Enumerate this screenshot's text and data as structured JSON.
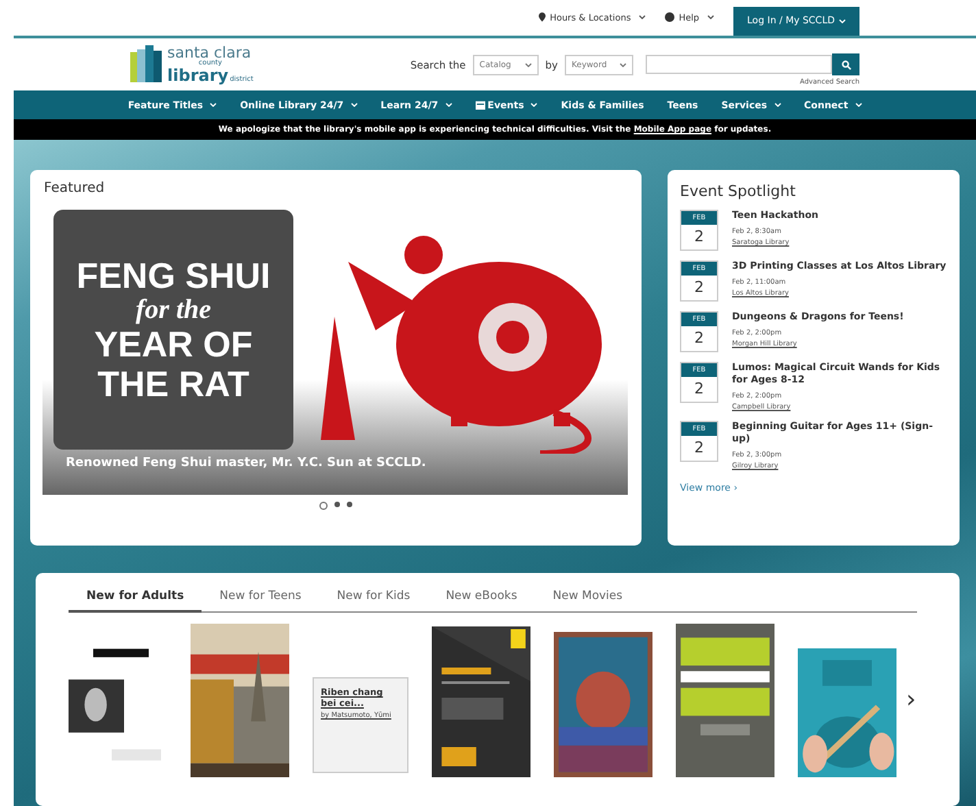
{
  "utility_bar": {
    "links": [
      {
        "label": "Hours & Locations"
      },
      {
        "label": "Help"
      }
    ],
    "login": "Log In / My SCCLD"
  },
  "logo": {
    "line1": "santa clara",
    "line2": "county",
    "line3": "library",
    "line4": "district"
  },
  "search": {
    "label": "Search the",
    "scope": "Catalog",
    "by": "by",
    "field": "Keyword",
    "advanced": "Advanced Search"
  },
  "nav": [
    {
      "label": "Feature Titles",
      "dropdown": true,
      "icon": false
    },
    {
      "label": "Online Library 24/7",
      "dropdown": true,
      "icon": false
    },
    {
      "label": "Learn 24/7",
      "dropdown": true,
      "icon": false
    },
    {
      "label": "Events",
      "dropdown": true,
      "icon": true
    },
    {
      "label": "Kids & Families",
      "dropdown": false,
      "icon": false
    },
    {
      "label": "Teens",
      "dropdown": false,
      "icon": false
    },
    {
      "label": "Services",
      "dropdown": true,
      "icon": false
    },
    {
      "label": "Connect",
      "dropdown": true,
      "icon": false
    }
  ],
  "alert": {
    "before": "We apologize that the library's mobile app is experiencing technical difficulties.  Visit the",
    "link": "Mobile App page",
    "after": "for updates."
  },
  "featured": {
    "title": "Featured",
    "banner_lines": [
      "FENG SHUI",
      "for the",
      "YEAR OF",
      "THE RAT"
    ],
    "caption": "Renowned Feng Shui master, Mr. Y.C. Sun at SCCLD.",
    "slides": [
      {
        "selected": true
      },
      {
        "selected": false
      },
      {
        "selected": false
      }
    ]
  },
  "events": {
    "title": "Event Spotlight",
    "items": [
      {
        "month": "FEB",
        "day": "2",
        "title": "Teen Hackathon",
        "time": "Feb 2, 8:30am",
        "location": "Saratoga Library"
      },
      {
        "month": "FEB",
        "day": "2",
        "title": "3D Printing Classes at Los Altos Library",
        "time": "Feb 2, 11:00am",
        "location": "Los Altos Library"
      },
      {
        "month": "FEB",
        "day": "2",
        "title": "Dungeons & Dragons for Teens!",
        "time": "Feb 2, 2:00pm",
        "location": "Morgan Hill Library"
      },
      {
        "month": "FEB",
        "day": "2",
        "title": "Lumos: Magical Circuit Wands for Kids for Ages 8-12",
        "time": "Feb 2, 2:00pm",
        "location": "Campbell Library"
      },
      {
        "month": "FEB",
        "day": "2",
        "title": "Beginning Guitar for Ages 11+ (Sign-up)",
        "time": "Feb 2, 3:00pm",
        "location": "Gilroy Library"
      }
    ],
    "more": "View more ›"
  },
  "new_titles": {
    "tabs": [
      {
        "label": "New for Adults",
        "selected": true
      },
      {
        "label": "New for Teens",
        "selected": false
      },
      {
        "label": "New for Kids",
        "selected": false
      },
      {
        "label": "New eBooks",
        "selected": false
      },
      {
        "label": "New Movies",
        "selected": false
      }
    ],
    "books": [
      {
        "kind": "picture"
      },
      {
        "kind": "picture"
      },
      {
        "kind": "text",
        "title": "Riben chang bei cei...",
        "author": "by Matsumoto, Yūmi"
      },
      {
        "kind": "picture"
      },
      {
        "kind": "picture"
      },
      {
        "kind": "picture"
      },
      {
        "kind": "picture"
      }
    ],
    "next": "›"
  }
}
